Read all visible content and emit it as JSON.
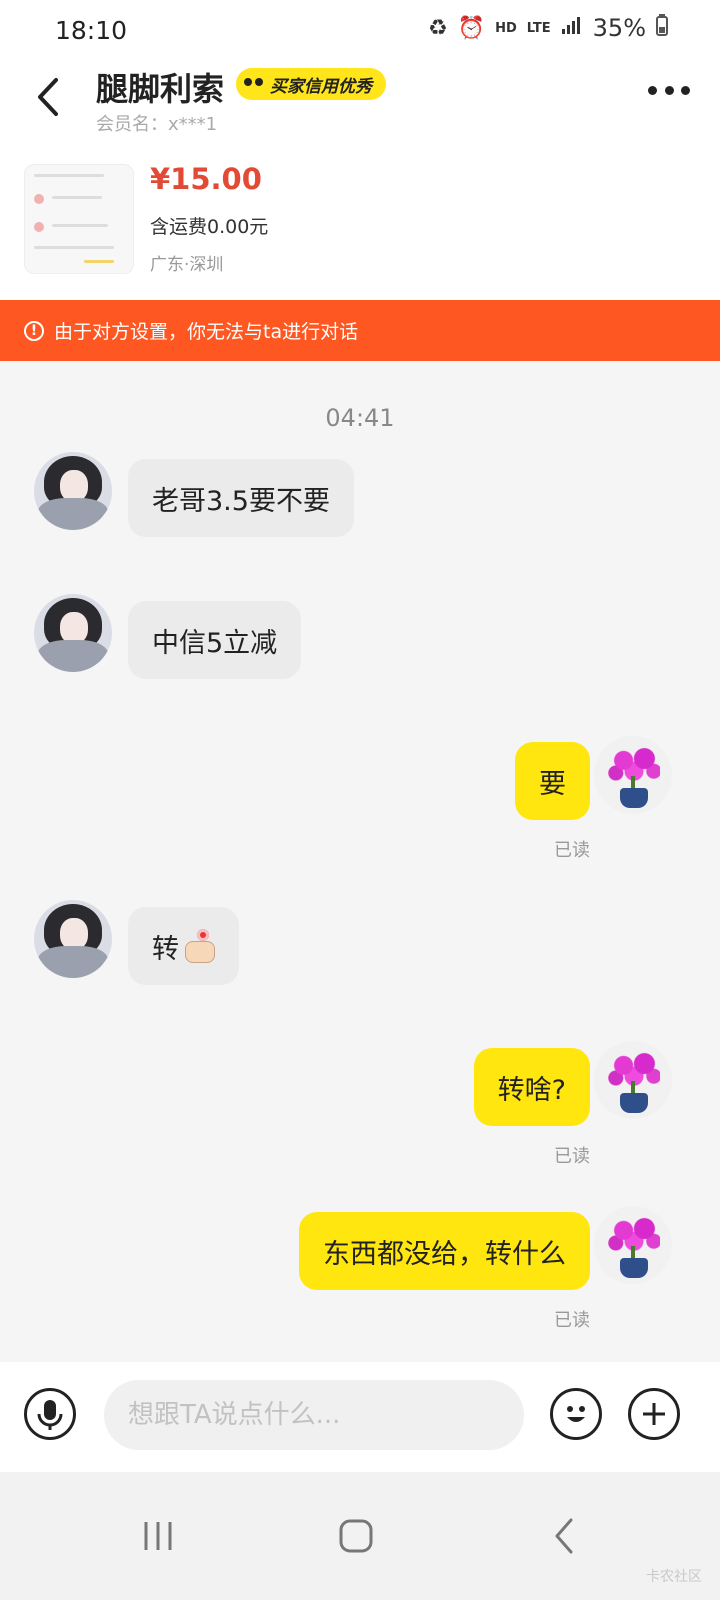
{
  "status_bar": {
    "time": "18:10",
    "network_hd": "HD",
    "network_lte": "LTE",
    "battery": "35%"
  },
  "header": {
    "title": "腿脚利索",
    "credit_badge": "买家信用优秀",
    "member": "会员名：x***1"
  },
  "product": {
    "price": "¥15.00",
    "shipping": "含运费0.00元",
    "location": "广东·深圳"
  },
  "warning": {
    "text": "由于对方设置，你无法与ta进行对话"
  },
  "chat": {
    "timestamp": "04:41",
    "messages": [
      {
        "direction": "in",
        "text": "老哥3.5要不要"
      },
      {
        "direction": "in",
        "text": "中信5立减"
      },
      {
        "direction": "out",
        "text": "要",
        "status": "已读"
      },
      {
        "direction": "in",
        "text": "转"
      },
      {
        "direction": "out",
        "text": "转啥?",
        "status": "已读"
      },
      {
        "direction": "out",
        "text": "东西都没给，转什么",
        "status": "已读"
      }
    ]
  },
  "input": {
    "placeholder": "想跟TA说点什么..."
  },
  "icons": {
    "back": "back-arrow-icon",
    "more": "more-dots-icon",
    "voice": "microphone-icon",
    "emoji": "smiley-icon",
    "plus": "plus-icon",
    "warning": "alert-circle-icon"
  },
  "colors": {
    "warning_bg": "#ff5722",
    "price": "#e24a36",
    "outgoing_bubble": "#ffe60f",
    "incoming_bubble": "#ebebeb",
    "badge_bg": "#ffe51a"
  },
  "watermark": "卡农社区"
}
